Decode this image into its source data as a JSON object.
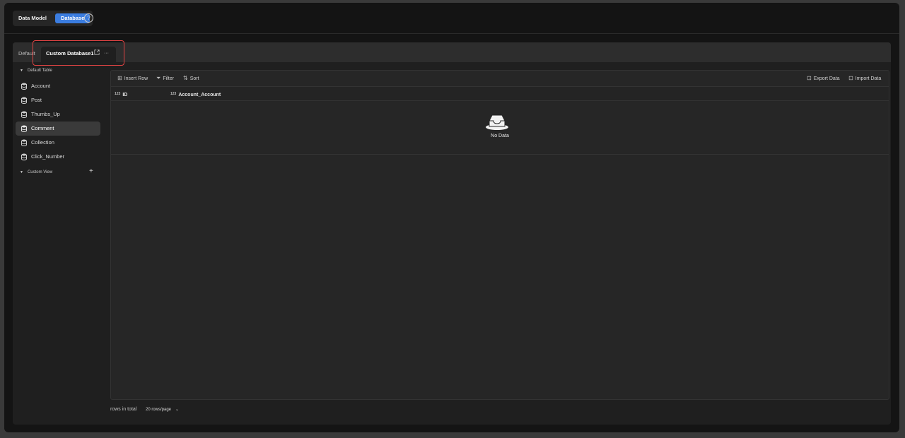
{
  "header": {
    "modes": [
      {
        "label": "Data Model",
        "active": false
      },
      {
        "label": "Database",
        "active": true
      }
    ],
    "help_icon": "?"
  },
  "tabs": {
    "default_label": "Default",
    "custom_label": "Custom Database1",
    "more_label": "···"
  },
  "sidebar": {
    "default_section": "Default Table",
    "items": [
      {
        "label": "Account"
      },
      {
        "label": "Post"
      },
      {
        "label": "Thumbs_Up"
      },
      {
        "label": "Comment",
        "selected": true
      },
      {
        "label": "Collection"
      },
      {
        "label": "Click_Number"
      }
    ],
    "custom_section": "Custom View",
    "add_label": "+"
  },
  "toolbar": {
    "insert_row": "Insert Row",
    "filter": "Filter",
    "sort": "Sort",
    "export": "Export Data",
    "import": "Import Data"
  },
  "table": {
    "type_badge": "123",
    "columns": [
      "ID",
      "Account_Account"
    ],
    "empty_text": "No Data"
  },
  "footer": {
    "rows_total": "rows in total",
    "page_size": "20 rows/page"
  },
  "colors": {
    "accent": "#3b7de0",
    "highlight": "#e24444"
  }
}
